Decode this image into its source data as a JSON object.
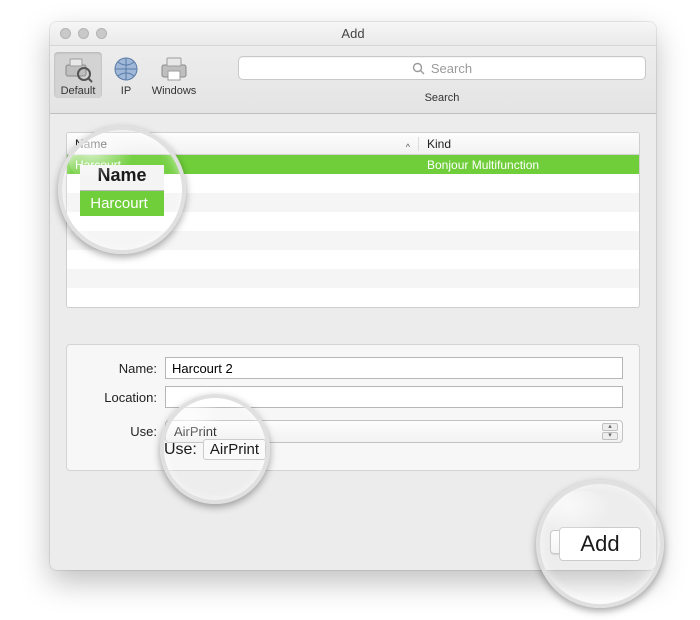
{
  "window": {
    "title": "Add"
  },
  "toolbar": {
    "items": [
      {
        "label": "Default",
        "selected": true
      },
      {
        "label": "IP",
        "selected": false
      },
      {
        "label": "Windows",
        "selected": false
      }
    ],
    "search": {
      "placeholder": "Search",
      "label": "Search"
    }
  },
  "list": {
    "headers": {
      "name": "Name",
      "kind": "Kind"
    },
    "sort_indicator": "^",
    "rows": [
      {
        "name": "Harcourt",
        "kind": "Bonjour Multifunction",
        "selected": true
      }
    ]
  },
  "form": {
    "labels": {
      "name": "Name:",
      "location": "Location:",
      "use": "Use:"
    },
    "values": {
      "name": "Harcourt 2",
      "location": "",
      "use": "AirPrint"
    }
  },
  "buttons": {
    "add": "Add"
  },
  "callouts": {
    "name_header": "Name",
    "name_row": "Harcourt",
    "use_label": "Use:",
    "use_value": "AirPrint",
    "add": "Add"
  }
}
